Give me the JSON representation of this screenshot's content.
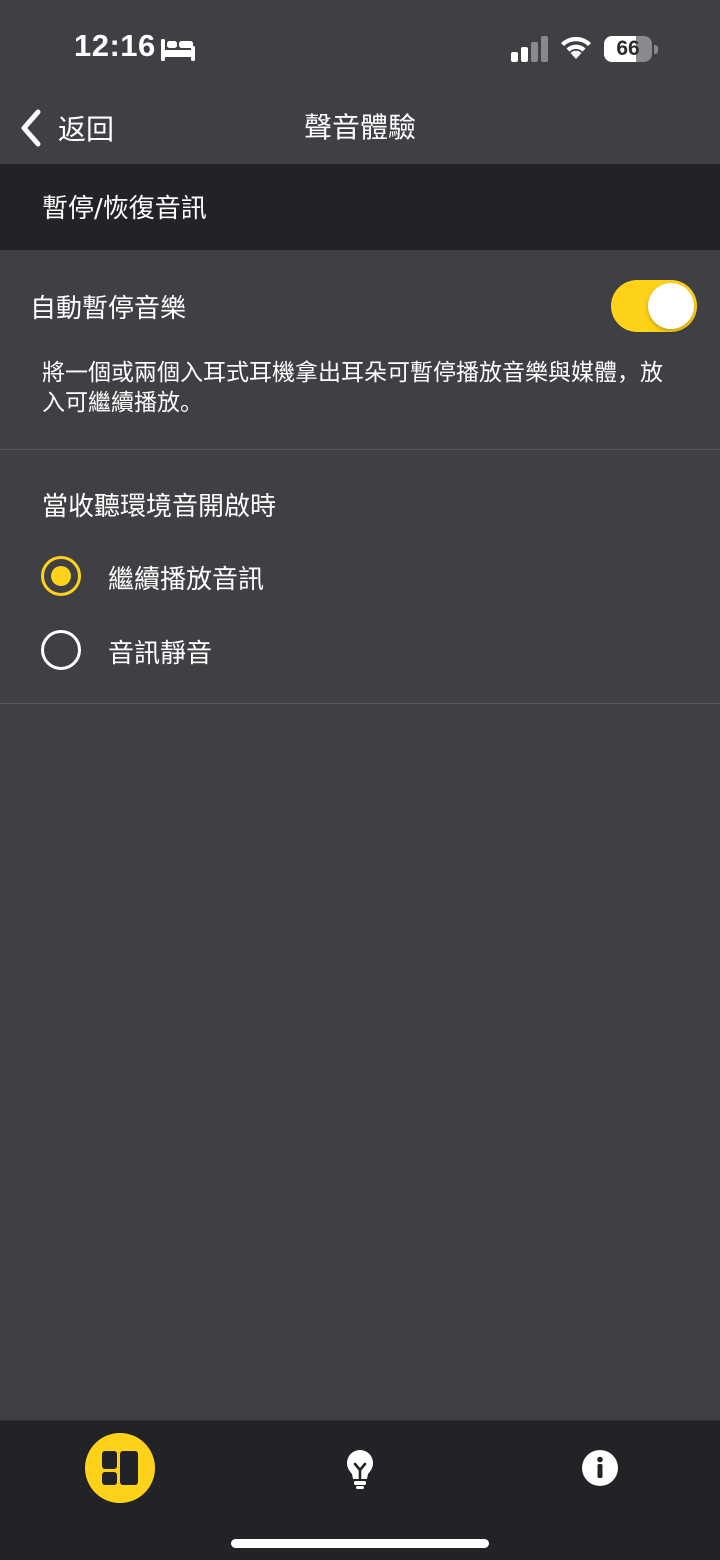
{
  "status_bar": {
    "time": "12:16",
    "battery_level": "66",
    "battery_fraction": 0.66,
    "icons": [
      "bed-icon",
      "cellular-signal-icon",
      "wifi-icon",
      "battery-icon"
    ]
  },
  "nav": {
    "back_label": "返回",
    "title": "聲音體驗"
  },
  "section_header": "暫停/恢復音訊",
  "auto_pause": {
    "label": "自動暫停音樂",
    "enabled": true,
    "description": "將一個或兩個入耳式耳機拿出耳朵可暫停播放音樂與媒體，放入可繼續播放。"
  },
  "ambient": {
    "title": "當收聽環境音開啟時",
    "options": [
      {
        "label": "繼續播放音訊",
        "selected": true
      },
      {
        "label": "音訊靜音",
        "selected": false
      }
    ]
  },
  "tab_bar": {
    "tabs": [
      {
        "icon": "dashboard-icon",
        "active": true
      },
      {
        "icon": "lightbulb-icon",
        "active": false
      },
      {
        "icon": "info-icon",
        "active": false
      }
    ]
  },
  "colors": {
    "accent": "#ffd21a",
    "background": "#3f4044",
    "header_band": "#222326",
    "tab_bar": "#222326"
  }
}
